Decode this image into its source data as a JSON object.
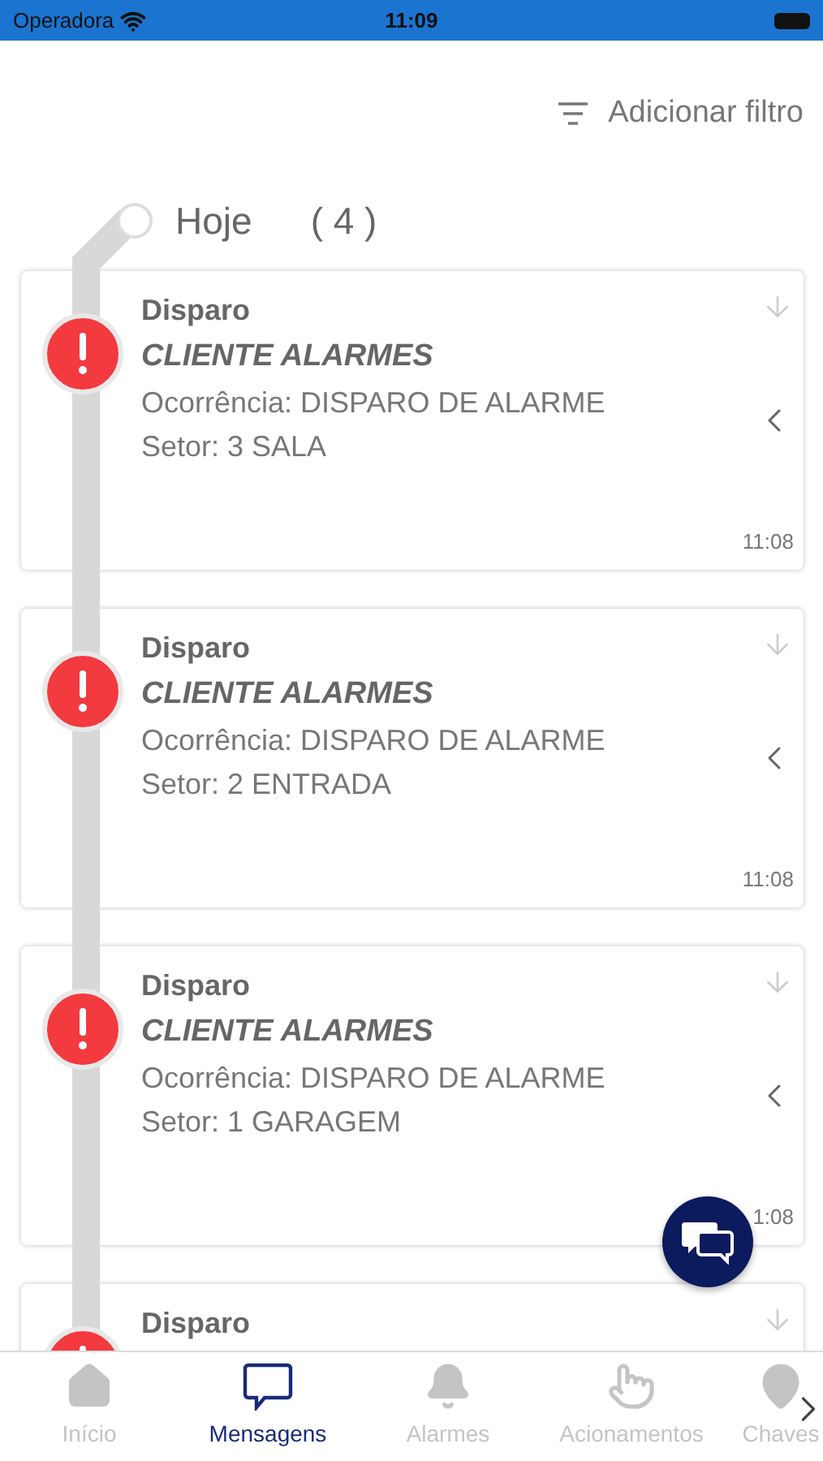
{
  "status_bar": {
    "carrier": "Operadora",
    "time": "11:09"
  },
  "filter_button": {
    "label": "Adicionar filtro"
  },
  "group": {
    "label": "Hoje",
    "count": "( 4 )"
  },
  "messages": [
    {
      "title": "Disparo",
      "client": "CLIENTE ALARMES",
      "occurrence": "Ocorrência: DISPARO DE ALARME",
      "sector": "Setor: 3 SALA",
      "time": "11:08"
    },
    {
      "title": "Disparo",
      "client": "CLIENTE ALARMES",
      "occurrence": "Ocorrência: DISPARO DE ALARME",
      "sector": "Setor: 2 ENTRADA",
      "time": "11:08"
    },
    {
      "title": "Disparo",
      "client": "CLIENTE ALARMES",
      "occurrence": "Ocorrência: DISPARO DE ALARME",
      "sector": "Setor: 1 GARAGEM",
      "time": "1:08"
    },
    {
      "title": "Disparo"
    }
  ],
  "tabs": [
    {
      "label": "Início",
      "selected": false
    },
    {
      "label": "Mensagens",
      "selected": true
    },
    {
      "label": "Alarmes",
      "selected": false
    },
    {
      "label": "Acionamentos",
      "selected": false
    },
    {
      "label": "Chaves",
      "selected": false
    }
  ]
}
